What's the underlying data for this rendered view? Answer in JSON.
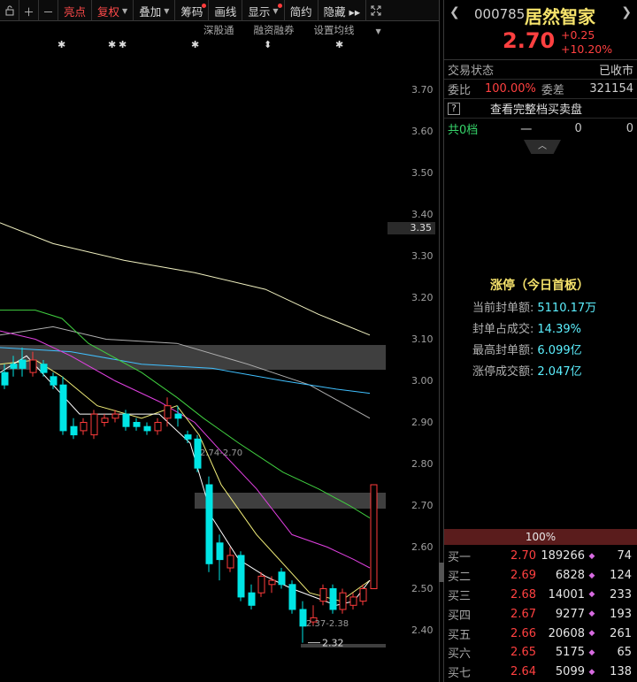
{
  "toolbar": {
    "buttons": [
      {
        "label": "亮点",
        "red": true
      },
      {
        "label": "复权",
        "red": true,
        "caret": true
      },
      {
        "label": "叠加",
        "caret": true
      },
      {
        "label": "筹码",
        "dot": true
      },
      {
        "label": "画线"
      },
      {
        "label": "显示",
        "caret": true,
        "dot": true
      },
      {
        "label": "简约"
      },
      {
        "label": "隐藏 ▸▸"
      }
    ]
  },
  "chart": {
    "links": {
      "shgt": "深股通",
      "margin": "融资融券",
      "ma_settings": "设置均线"
    },
    "price_ticks": [
      "3.70",
      "3.60",
      "3.50",
      "3.40",
      "3.30",
      "3.20",
      "3.10",
      "3.00",
      "2.90",
      "2.80",
      "2.70",
      "2.60",
      "2.50",
      "2.40"
    ],
    "current_price_tag": "3.35",
    "annotation_gap": "2.74-2.70",
    "annotation_gap2": "2.37-2.38",
    "annotation_low": "2.32",
    "colors": {
      "up": "#ff3b3b",
      "down": "#00e5e5",
      "ma5": "#ffffff",
      "ma10": "#f3ef7a",
      "ma20": "#e040e0",
      "ma30": "#40d040",
      "ma60": "#b0b0b0",
      "ma120": "#40c0ff",
      "ma250": "#f0f0c0"
    }
  },
  "quote": {
    "code": "000785",
    "name": "居然智家",
    "price": "2.70",
    "change": "+0.25",
    "change_pct": "+10.20%",
    "trade_status_label": "交易状态",
    "trade_status": "已收市",
    "weibi_label": "委比",
    "weibi": "100.00%",
    "weicha_label": "委差",
    "weicha": "321154",
    "full_depth_label": "查看完整档买卖盘",
    "total_label": "共0档",
    "total_dash": "一",
    "total_a": "0",
    "total_b": "0"
  },
  "limit_up": {
    "title": "涨停（今日首板）",
    "rows": [
      {
        "label": "当前封单额:",
        "value": "5110.17万"
      },
      {
        "label": "封单占成交:",
        "value": "14.39%"
      },
      {
        "label": "最高封单额:",
        "value": "6.099亿"
      },
      {
        "label": "涨停成交额:",
        "value": "2.047亿"
      }
    ]
  },
  "bid_pct": "100%",
  "bids": [
    {
      "label": "买一",
      "price": "2.70",
      "vol": "189266",
      "n": "74"
    },
    {
      "label": "买二",
      "price": "2.69",
      "vol": "6828",
      "n": "124"
    },
    {
      "label": "买三",
      "price": "2.68",
      "vol": "14001",
      "n": "233"
    },
    {
      "label": "买四",
      "price": "2.67",
      "vol": "9277",
      "n": "193"
    },
    {
      "label": "买五",
      "price": "2.66",
      "vol": "20608",
      "n": "261"
    },
    {
      "label": "买六",
      "price": "2.65",
      "vol": "5175",
      "n": "65"
    },
    {
      "label": "买七",
      "price": "2.64",
      "vol": "5099",
      "n": "138"
    }
  ]
}
